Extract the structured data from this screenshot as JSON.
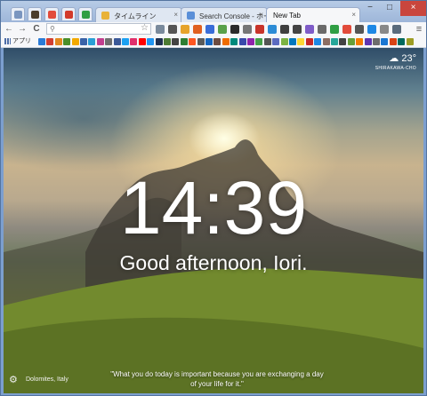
{
  "browser": {
    "tabs": [
      {
        "label": "タイムライン",
        "favicon_color": "#e8b23a",
        "active": false
      },
      {
        "label": "Search Console - ホー",
        "favicon_color": "#5a8fd8",
        "active": false
      },
      {
        "label": "New Tab",
        "active": true
      }
    ],
    "pinned_tab_colors": [
      "#7a95bf",
      "#4a3c2a",
      "#e24b3b",
      "#d23a2a",
      "#2f9e44"
    ],
    "close_glyph": "×",
    "window_controls": [
      "−",
      "□",
      "×"
    ],
    "toolbar": {
      "back": "←",
      "forward": "→",
      "reload": "C",
      "search_icon": "search-icon",
      "star_icon": "star-icon",
      "extension_colors": [
        "#7a8a9c",
        "#555",
        "#e6a32b",
        "#e06020",
        "#3a6dd8",
        "#5aa14a",
        "#2b2b2b",
        "#777",
        "#c8342a",
        "#2d8cd6",
        "#3f3f3f",
        "#444",
        "#7f5cc8",
        "#6a6a6a",
        "#2f9e44",
        "#e24b3b",
        "#555",
        "#1e88e5",
        "#888",
        "#5a6b7c"
      ],
      "menu": "≡"
    },
    "bookmarks": {
      "apps_label": "アプリ",
      "colors": [
        "#2b7bd6",
        "#d23f31",
        "#e38a1f",
        "#4b8f29",
        "#f2a900",
        "#3a63a8",
        "#2a9fd6",
        "#c23f8f",
        "#6f6f6f",
        "#3b5998",
        "#1da1f2",
        "#e1306c",
        "#ff0000",
        "#2196f3",
        "#1f2f4f",
        "#4d7b33",
        "#444",
        "#2e7d32",
        "#ff5722",
        "#5a5a5a",
        "#1565c0",
        "#6d4c41",
        "#ef6c00",
        "#00897b",
        "#3949ab",
        "#8e24aa",
        "#43a047",
        "#555",
        "#5c6bc0",
        "#7cb342",
        "#0277bd",
        "#fdd835",
        "#c62828",
        "#1e88e5",
        "#8d6e63",
        "#26a69a",
        "#424242",
        "#689f38",
        "#f57c00",
        "#5e35b1",
        "#6d6d6d",
        "#1976d2",
        "#d84315",
        "#00695c",
        "#9e9d24"
      ]
    }
  },
  "dashboard": {
    "weather": {
      "temperature": "23°",
      "location": "SHIRAKAWA-CHO",
      "icon": "cloud-rain-icon"
    },
    "clock": "14:39",
    "greeting": "Good afternoon, Iori.",
    "photo_location": "Dolomites, Italy",
    "settings_icon": "gear-icon",
    "quote": "\"What you do today is important because you are exchanging a day of your life for it.\""
  }
}
